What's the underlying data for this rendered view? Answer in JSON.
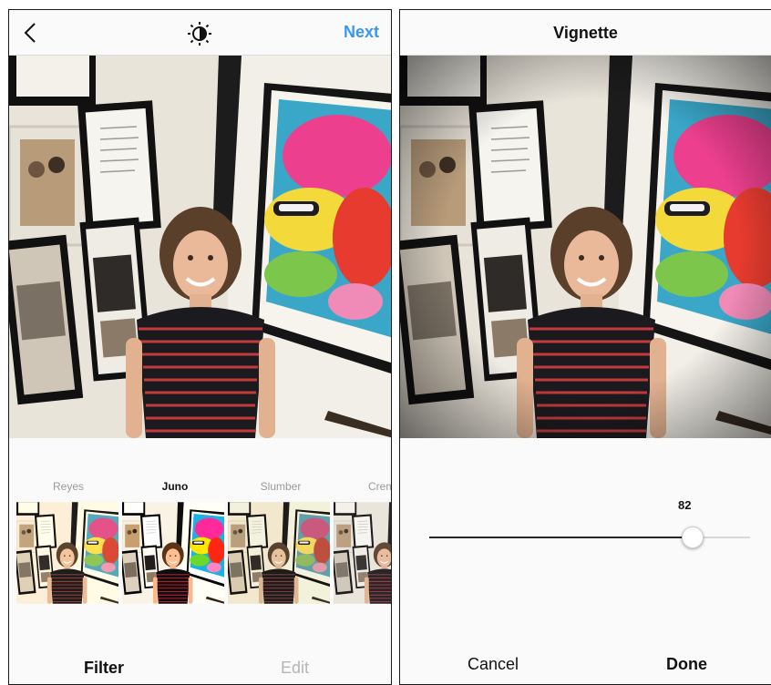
{
  "filter_screen": {
    "header": {
      "back_icon": "chevron-left-icon",
      "lux_icon": "lux-sun-icon",
      "next_label": "Next",
      "accent_color": "#3897f0"
    },
    "filters": [
      {
        "label": "Reyes",
        "selected": false
      },
      {
        "label": "Juno",
        "selected": true
      },
      {
        "label": "Slumber",
        "selected": false
      },
      {
        "label": "Crema",
        "selected": false
      }
    ],
    "bottom_tabs": {
      "filter_label": "Filter",
      "edit_label": "Edit",
      "active": "Filter"
    }
  },
  "vignette_screen": {
    "header": {
      "title": "Vignette"
    },
    "slider": {
      "value": "82",
      "fraction": 0.82
    },
    "footer": {
      "cancel_label": "Cancel",
      "done_label": "Done"
    }
  }
}
